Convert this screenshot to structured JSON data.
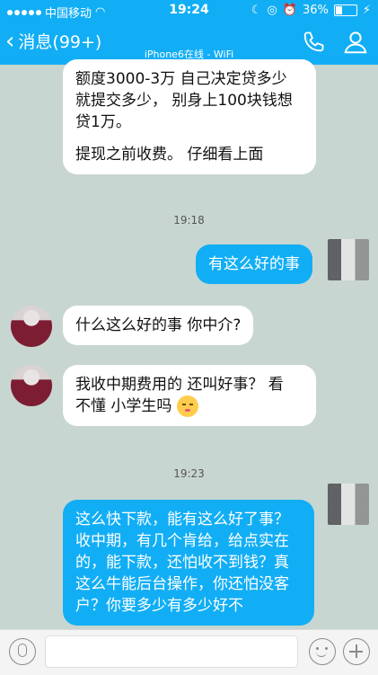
{
  "status_bar": {
    "carrier": "中国移动",
    "time": "19:24",
    "battery": "36%"
  },
  "header": {
    "back_label": "消息(99+)",
    "subtitle": "iPhone6在线 - WiFi"
  },
  "messages": [
    {
      "side": "in",
      "lines": [
        "额度3000-3万 自己决定贷多少",
        "就提交多少， 别身上100块钱想",
        "贷1万。",
        "",
        "提现之前收费。 仔细看上面"
      ]
    },
    {
      "type": "time",
      "text": "19:18"
    },
    {
      "side": "out",
      "text": "有这么好的事"
    },
    {
      "side": "in",
      "text": "什么这么好的事 你中介?"
    },
    {
      "side": "in",
      "line1": "我收中期费用的 还叫好事？ 看",
      "line2": "不懂 小学生吗"
    },
    {
      "type": "time",
      "text": "19:23"
    },
    {
      "side": "out",
      "lines": [
        "这么快下款，能有这么好了事？",
        "收中期，有几个肯给，给点实在",
        "的，能下款，还怕收不到钱？真",
        "这么牛能后台操作，你还怕没客",
        "户？你要多少有多少好不"
      ]
    }
  ],
  "icons": {
    "call": "phone-icon",
    "profile": "user-icon",
    "voice": "microphone-icon",
    "emoji": "smiley-icon",
    "more": "plus-icon"
  },
  "colors": {
    "accent": "#12aef5",
    "chat_bg": "#c8d6d1"
  }
}
